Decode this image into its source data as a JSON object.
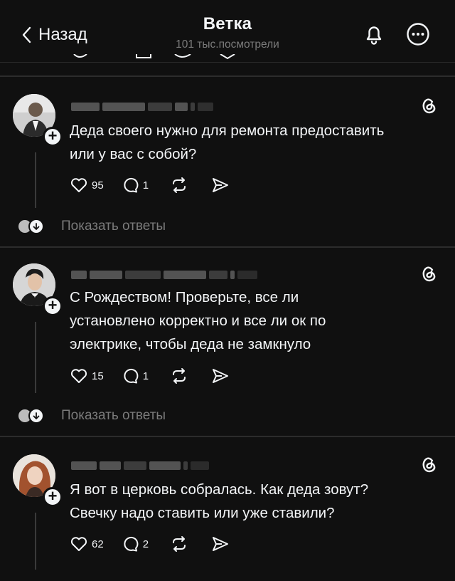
{
  "header": {
    "back_label": "Назад",
    "title": "Ветка",
    "views": "101 тыс.посмотрели"
  },
  "posts": [
    {
      "text": "Деда своего нужно для ремонта предоставить\nили у вас с собой?",
      "likes": "95",
      "replies": "1",
      "show_replies": "Показать ответы"
    },
    {
      "text": "С Рождеством! Проверьте, все ли\nустановлено корректно и все ли ок по\nэлектрике, чтобы деда не замкнуло",
      "likes": "15",
      "replies": "1",
      "show_replies": "Показать ответы"
    },
    {
      "text": "Я вот в церковь собралась. Как деда зовут?\nСвечку надо ставить или уже ставили?",
      "likes": "62",
      "replies": "2"
    }
  ],
  "icons": {
    "back": "chevron-left-icon",
    "notifications": "bell-icon",
    "more": "more-horizontal-icon",
    "brand": "threads-logo-icon",
    "like": "heart-icon",
    "reply": "comment-icon",
    "repost": "repost-icon",
    "share": "send-icon"
  },
  "colors": {
    "background": "#101010",
    "text": "#f3f5f7",
    "muted": "#7b7b7b",
    "divider": "#2c2c2c"
  }
}
